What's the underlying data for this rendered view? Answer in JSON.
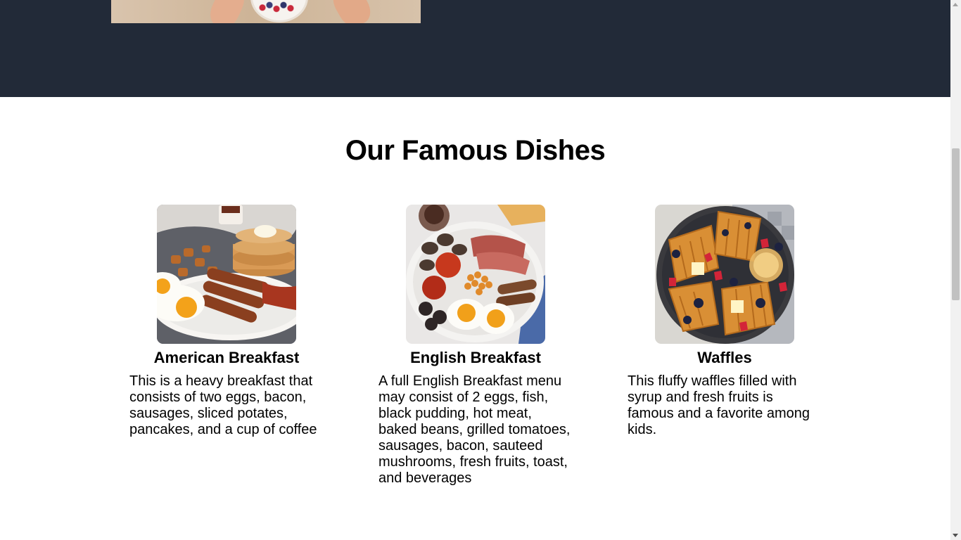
{
  "hero": {
    "image_alt": "breakfast-table-photo"
  },
  "dishes_section": {
    "title": "Our Famous Dishes",
    "items": [
      {
        "name": "American Breakfast",
        "description": "This is a heavy breakfast that consists of two eggs, bacon, sausages, sliced potates, pancakes, and a cup of coffee",
        "image": "american-breakfast-photo"
      },
      {
        "name": "English Breakfast",
        "description": "A full English Breakfast menu may consist of 2 eggs, fish, black pudding, hot meat, baked beans, grilled tomatoes, sausages, bacon, sauteed mushrooms, fresh fruits, toast, and beverages",
        "image": "english-breakfast-photo"
      },
      {
        "name": "Waffles",
        "description": "This fluffy waffles filled with syrup and fresh fruits is famous and a favorite among kids.",
        "image": "waffles-photo"
      }
    ]
  },
  "colors": {
    "hero_background": "#222a38",
    "page_background": "#ffffff",
    "text": "#000000"
  }
}
